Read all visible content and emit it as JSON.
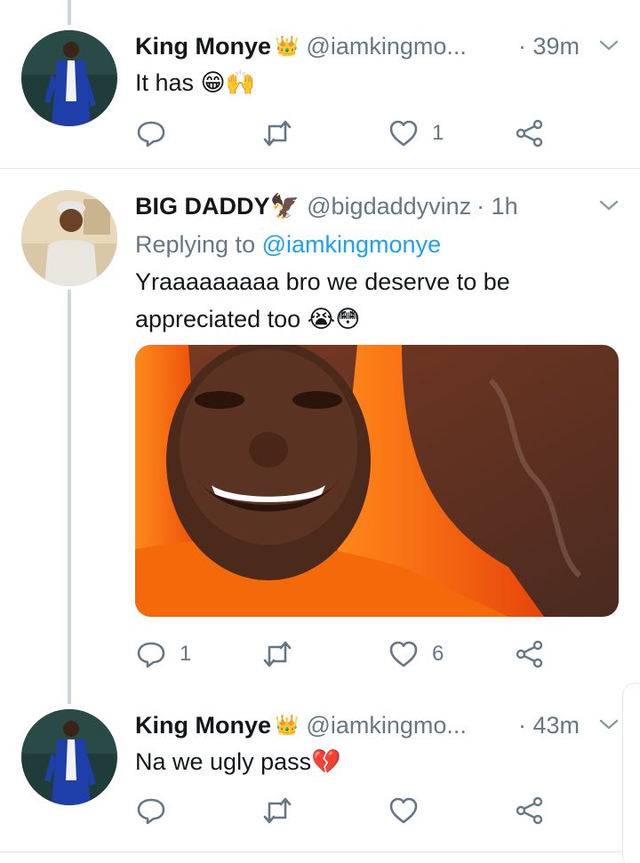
{
  "tweets": [
    {
      "name": "King Monye",
      "badge": "👑",
      "handle": "@iamkingmo...",
      "time": "· 39m",
      "text": "It has 😁🙌",
      "actions": {
        "reply_count": "",
        "retweet_count": "",
        "like_count": "1"
      }
    },
    {
      "name": "BIG DADDY🦅",
      "badge": "",
      "handle": "@bigdaddyvinz",
      "time": "· 1h",
      "replying_label": "Replying to",
      "replying_to": "@iamkingmonye",
      "text_line1": "Yraaaaaaaaa bro we deserve to be",
      "text_line2": "appreciated too 😭😳",
      "actions": {
        "reply_count": "1",
        "retweet_count": "",
        "like_count": "6"
      }
    },
    {
      "name": "King Monye",
      "badge": "👑",
      "handle": "@iamkingmo...",
      "time": "· 43m",
      "text": "Na we ugly pass💔",
      "actions": {
        "reply_count": "",
        "retweet_count": "",
        "like_count": ""
      }
    }
  ],
  "icons": {
    "reply": "reply-icon",
    "retweet": "retweet-icon",
    "like": "heart-icon",
    "share": "share-icon",
    "more": "chevron-down-icon"
  },
  "colors": {
    "link": "#1da1f2",
    "secondary": "#657786",
    "divider": "#e1e8ed",
    "thread_line": "#ccd6dd",
    "media_hoodie": "#f25c05"
  }
}
